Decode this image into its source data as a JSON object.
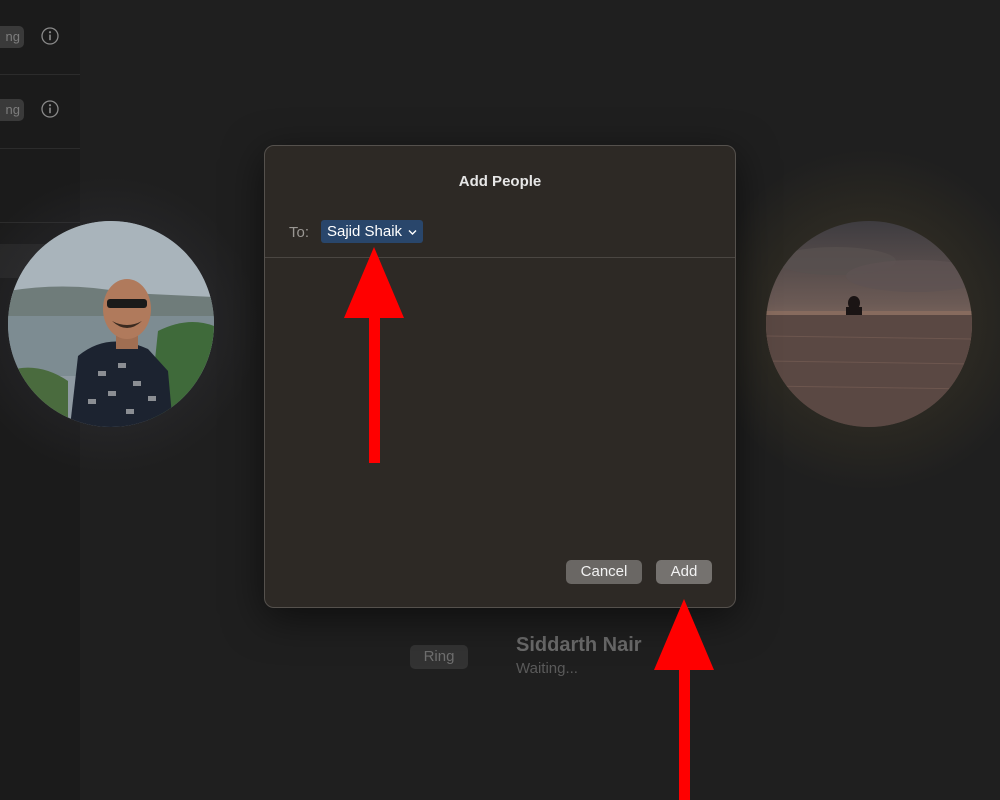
{
  "sidebar": {
    "rows": [
      {
        "ring_label": "ng"
      },
      {
        "ring_label": "ng"
      }
    ]
  },
  "call": {
    "ring_label": "Ring",
    "participant_name": "Siddarth Nair",
    "participant_status": "Waiting..."
  },
  "dialog": {
    "title": "Add People",
    "to_label": "To:",
    "recipient": "Sajid Shaik",
    "cancel_label": "Cancel",
    "add_label": "Add"
  },
  "colors": {
    "dialog_bg": "#2d2925",
    "token_bg": "#29466b",
    "button_bg": "#6a6764",
    "arrow": "#ff0000"
  },
  "icons": [
    "info-icon",
    "pencil-icon",
    "chevron-down-icon",
    "red-arrow"
  ]
}
